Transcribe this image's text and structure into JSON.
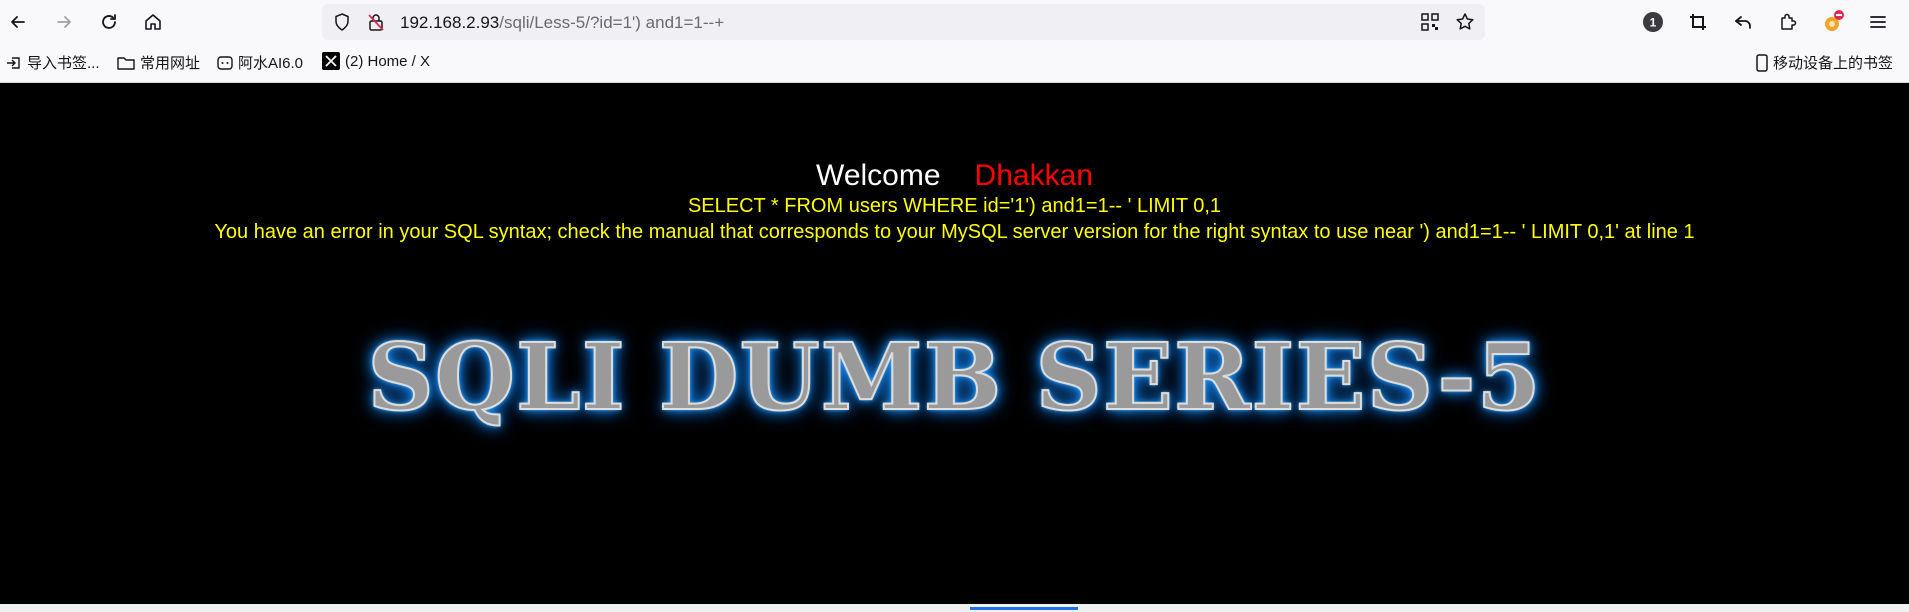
{
  "browser": {
    "url_host": "192.168.2.93",
    "url_path": "/sqli/Less-5/?id=1') and1=1--+",
    "badge_count": "1",
    "bookmarks": [
      {
        "label": "导入书签...",
        "icon": "import-icon"
      },
      {
        "label": "常用网址",
        "icon": "folder-icon"
      },
      {
        "label": "阿水AI6.0",
        "icon": "ai-icon"
      },
      {
        "label": "(2) Home / X",
        "icon": "x-logo-icon"
      }
    ],
    "mobile_bookmarks": "移动设备上的书签"
  },
  "page": {
    "welcome": "Welcome",
    "name": "Dhakkan",
    "sql_query": "SELECT * FROM users WHERE id='1') and1=1-- ' LIMIT 0,1",
    "sql_error": "You have an error in your SQL syntax; check the manual that corresponds to your MySQL server version for the right syntax to use near ') and1=1-- ' LIMIT 0,1' at line 1",
    "banner": "SQLI DUMB SERIES-5"
  },
  "colors": {
    "welcome": "#ffffff",
    "name": "#ff0000",
    "sql_text": "#ffff00",
    "banner_glow": "#1a8cff",
    "page_bg": "#000000"
  }
}
